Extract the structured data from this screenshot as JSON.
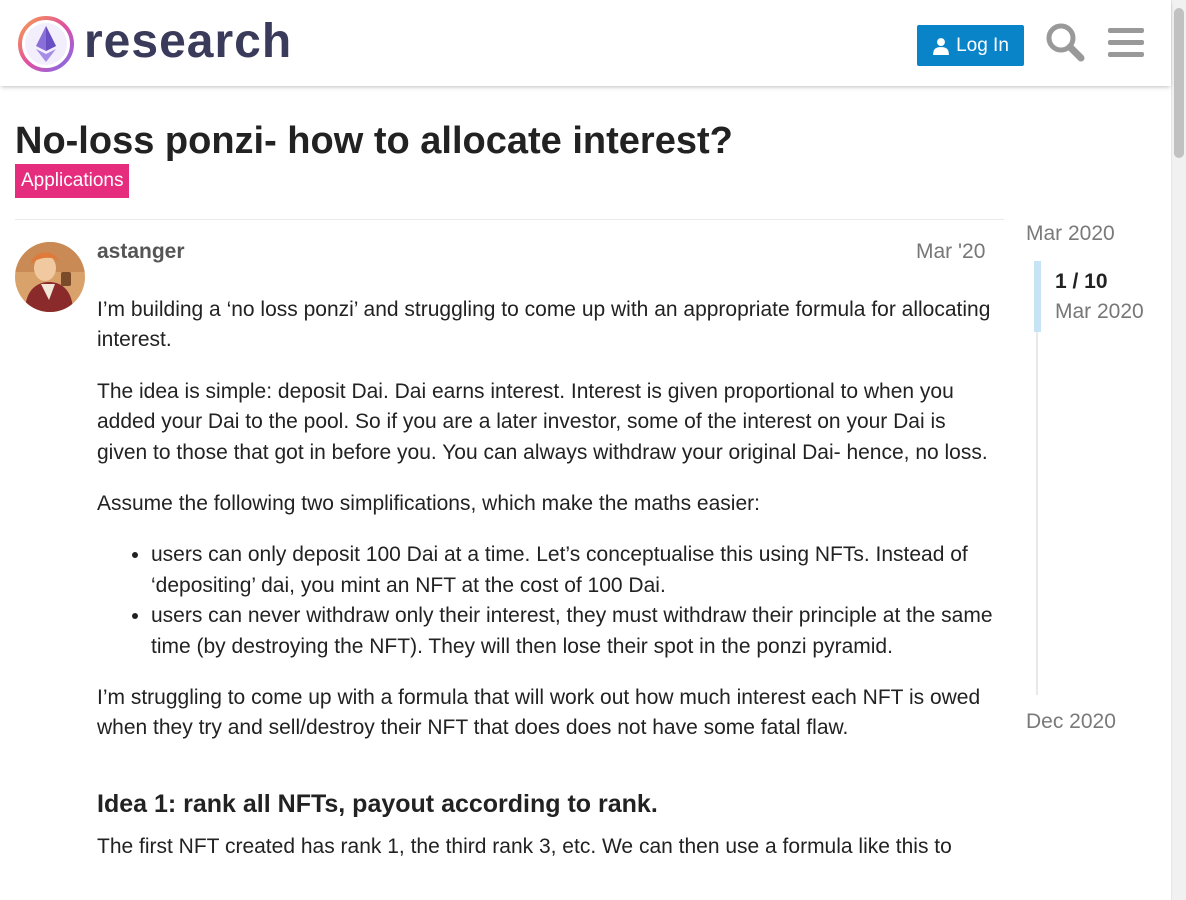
{
  "header": {
    "logo_text": "research",
    "login_label": "Log In"
  },
  "topic": {
    "title": "No-loss ponzi- how to allocate interest?",
    "category": "Applications"
  },
  "post": {
    "author": "astanger",
    "date": "Mar '20",
    "paragraphs": [
      "I’m building a ‘no loss ponzi’ and struggling to come up with an appropriate formula for allocating interest.",
      "The idea is simple: deposit Dai. Dai earns interest. Interest is given proportional to when you added your Dai to the pool. So if you are a later investor, some of the interest on your Dai is given to those that got in before you. You can always withdraw your original Dai- hence, no loss.",
      "Assume the following two simplifications, which make the maths easier:"
    ],
    "list": [
      "users can only deposit 100 Dai at a time. Let’s conceptualise this using NFTs. Instead of ‘depositing’ dai, you mint an NFT at the cost of 100 Dai.",
      "users can never withdraw only their interest, they must withdraw their principle at the same time (by destroying the NFT). They will then lose their spot in the ponzi pyramid."
    ],
    "after_list": "I’m struggling to come up with a formula that will work out how much interest each NFT is owed when they try and sell/destroy their NFT that does does not have some fatal flaw.",
    "heading": "Idea 1: rank all NFTs, payout according to rank.",
    "last_paragraph": "The first NFT created has rank 1, the third rank 3, etc. We can then use a formula like this to"
  },
  "timeline": {
    "start": "Mar 2020",
    "count": "1 / 10",
    "current": "Mar 2020",
    "end": "Dec 2020"
  },
  "colors": {
    "accent": "#0a84c9",
    "category": "#e62c7d"
  }
}
